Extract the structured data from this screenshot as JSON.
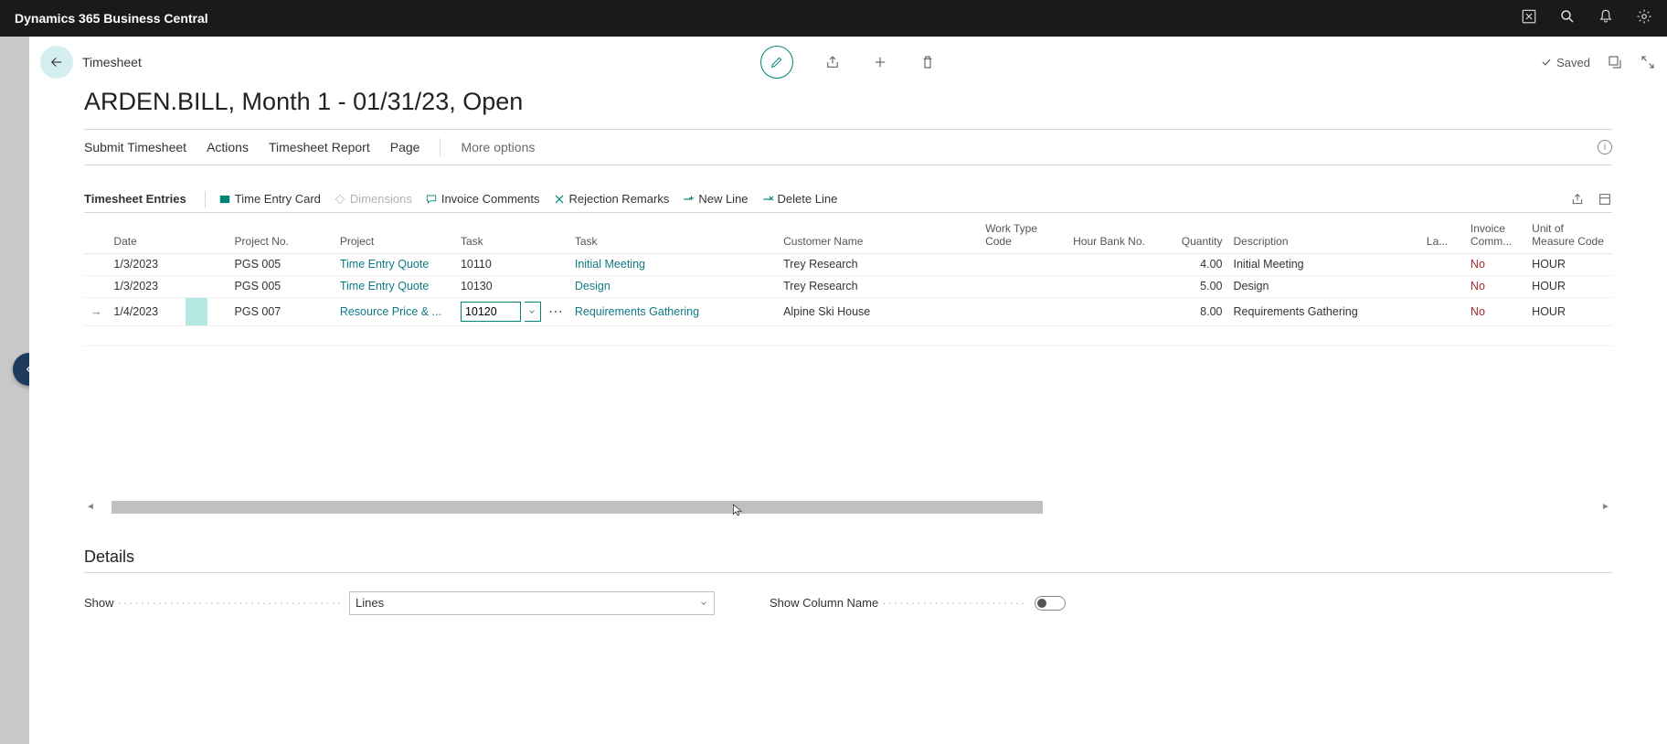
{
  "topbar": {
    "app_title": "Dynamics 365 Business Central"
  },
  "header": {
    "breadcrumb": "Timesheet",
    "saved_label": "Saved"
  },
  "page_title": "ARDEN.BILL, Month 1 - 01/31/23, Open",
  "menubar": {
    "submit": "Submit Timesheet",
    "actions": "Actions",
    "report": "Timesheet Report",
    "page": "Page",
    "more": "More options"
  },
  "section": {
    "label": "Timesheet Entries",
    "time_entry_card": "Time Entry Card",
    "dimensions": "Dimensions",
    "invoice_comments": "Invoice Comments",
    "rejection_remarks": "Rejection Remarks",
    "new_line": "New Line",
    "delete_line": "Delete Line"
  },
  "columns": {
    "date": "Date",
    "project_no": "Project No.",
    "project": "Project",
    "task_no": "Task",
    "task": "Task",
    "customer": "Customer Name",
    "work_type": "Work Type Code",
    "hour_bank": "Hour Bank No.",
    "quantity": "Quantity",
    "description": "Description",
    "la": "La...",
    "inv_comm": "Invoice Comm...",
    "uom": "Unit of Measure Code"
  },
  "rows": [
    {
      "date": "1/3/2023",
      "project_no": "PGS 005",
      "project": "Time Entry Quote",
      "task_no": "10110",
      "task": "Initial Meeting",
      "customer": "Trey Research",
      "qty": "4.00",
      "desc": "Initial Meeting",
      "inv": "No",
      "uom": "HOUR"
    },
    {
      "date": "1/3/2023",
      "project_no": "PGS 005",
      "project": "Time Entry Quote",
      "task_no": "10130",
      "task": "Design",
      "customer": "Trey Research",
      "qty": "5.00",
      "desc": "Design",
      "inv": "No",
      "uom": "HOUR"
    },
    {
      "date": "1/4/2023",
      "project_no": "PGS 007",
      "project": "Resource Price & ...",
      "task_no": "10120",
      "task": "Requirements Gathering",
      "customer": "Alpine Ski House",
      "qty": "8.00",
      "desc": "Requirements Gathering",
      "inv": "No",
      "uom": "HOUR"
    }
  ],
  "details": {
    "heading": "Details",
    "show_label": "Show",
    "show_value": "Lines",
    "col_name_label": "Show Column Name"
  }
}
